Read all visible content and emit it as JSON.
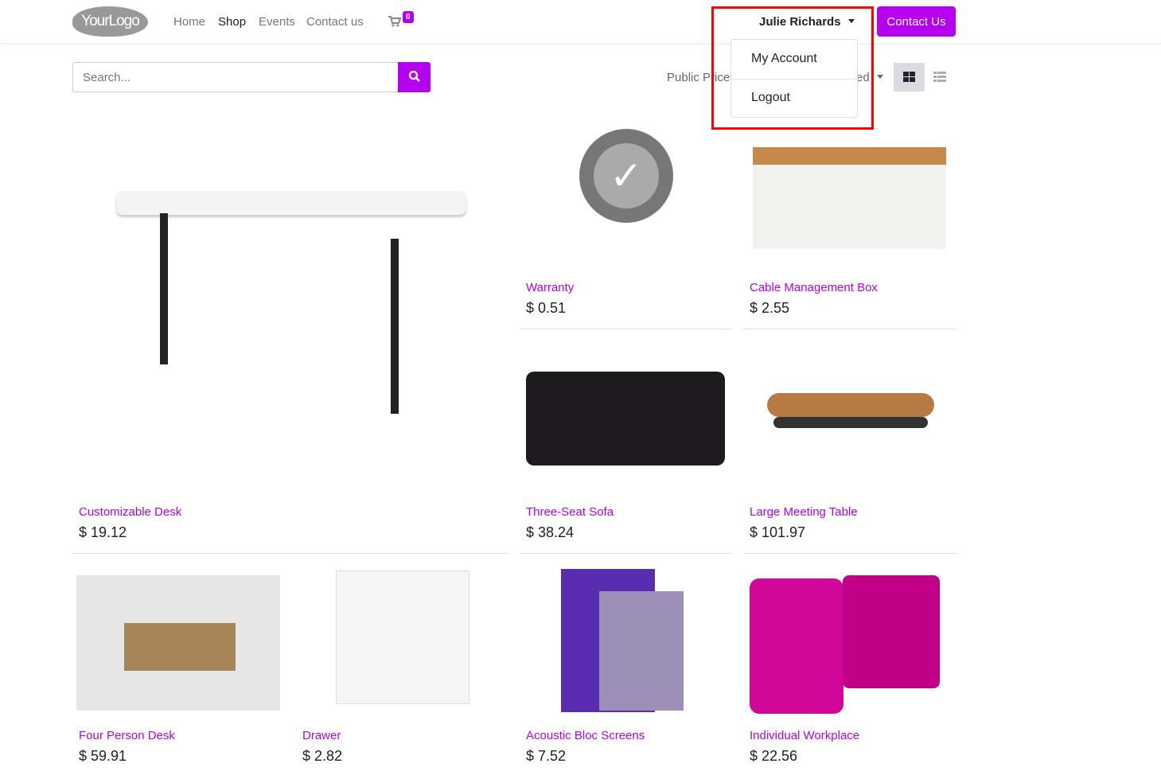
{
  "header": {
    "logo": "YourLogo",
    "nav": [
      "Home",
      "Shop",
      "Events",
      "Contact us"
    ],
    "active": "Shop",
    "cart_count": "0",
    "user": "Julie Richards",
    "contact_button": "Contact Us"
  },
  "user_menu": {
    "items": [
      "My Account",
      "Logout"
    ]
  },
  "toolbar": {
    "search_placeholder": "Search...",
    "pricelist_label": "Public Pricel",
    "sort_label_fragment": "ed"
  },
  "colors": {
    "accent": "#b600f0",
    "highlight": "#ff0000"
  },
  "products": [
    {
      "name": "Customizable Desk",
      "price": "$ 19.12"
    },
    {
      "name": "Warranty",
      "price": "$ 0.51"
    },
    {
      "name": "Cable Management Box",
      "price": "$ 2.55"
    },
    {
      "name": "Three-Seat Sofa",
      "price": "$ 38.24"
    },
    {
      "name": "Large Meeting Table",
      "price": "$ 101.97"
    },
    {
      "name": "Four Person Desk",
      "price": "$ 59.91"
    },
    {
      "name": "Drawer",
      "price": "$ 2.82"
    },
    {
      "name": "Acoustic Bloc Screens",
      "price": "$ 7.52"
    },
    {
      "name": "Individual Workplace",
      "price": "$ 22.56"
    }
  ]
}
